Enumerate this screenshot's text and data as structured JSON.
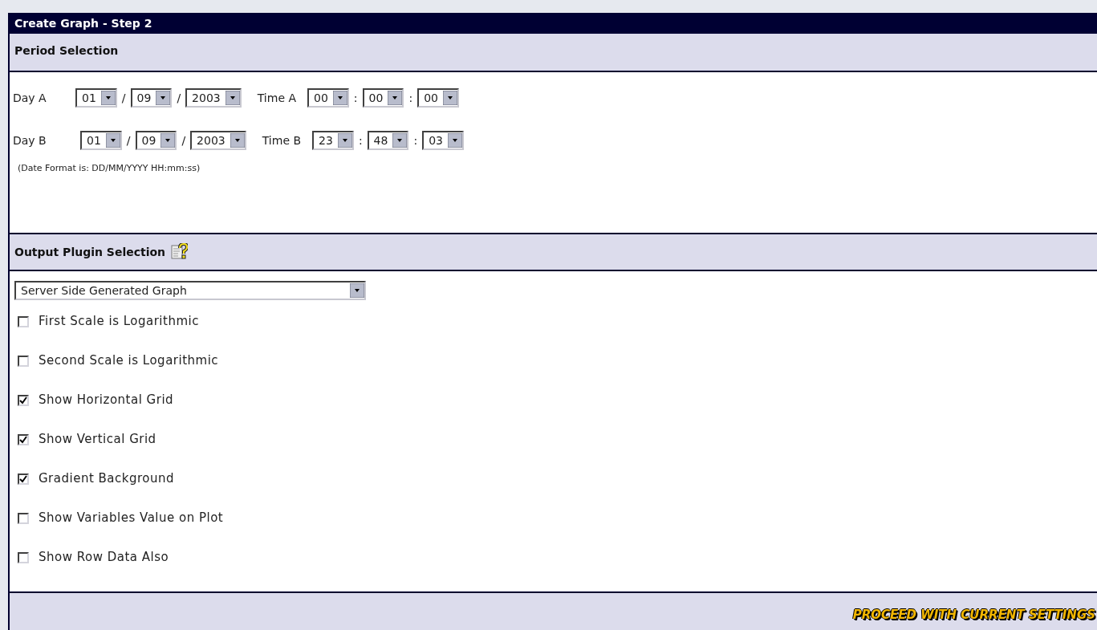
{
  "window": {
    "title": "Create Graph - Step 2"
  },
  "period": {
    "title": "Period Selection",
    "rows": [
      {
        "day_label": "Day A",
        "date_parts": [
          "01",
          "09",
          "2003"
        ],
        "date_separators": [
          "/",
          "/"
        ],
        "time_label": "Time A",
        "time_parts": [
          "00",
          "00",
          "00"
        ],
        "time_separators": [
          ":",
          ":"
        ]
      },
      {
        "day_label": "Day B",
        "date_parts": [
          "01",
          "09",
          "2003"
        ],
        "date_separators": [
          "/",
          "/"
        ],
        "time_label": "Time B",
        "time_parts": [
          "23",
          "48",
          "03"
        ],
        "time_separators": [
          ":",
          ":"
        ]
      }
    ],
    "note": "(Date Format is: DD/MM/YYYY HH:mm:ss)"
  },
  "output": {
    "title": "Output Plugin Selection",
    "plugin": "Server Side Generated Graph",
    "options": [
      {
        "label": "First Scale is Logarithmic",
        "checked": false
      },
      {
        "label": "Second Scale is Logarithmic",
        "checked": false
      },
      {
        "label": "Show Horizontal Grid",
        "checked": true
      },
      {
        "label": "Show Vertical Grid",
        "checked": true
      },
      {
        "label": "Gradient Background",
        "checked": true
      },
      {
        "label": "Show Variables Value on Plot",
        "checked": false
      },
      {
        "label": "Show Row Data Also",
        "checked": false
      }
    ]
  },
  "footer": {
    "action": "PROCEED WITH CURRENT SETTINGS"
  }
}
